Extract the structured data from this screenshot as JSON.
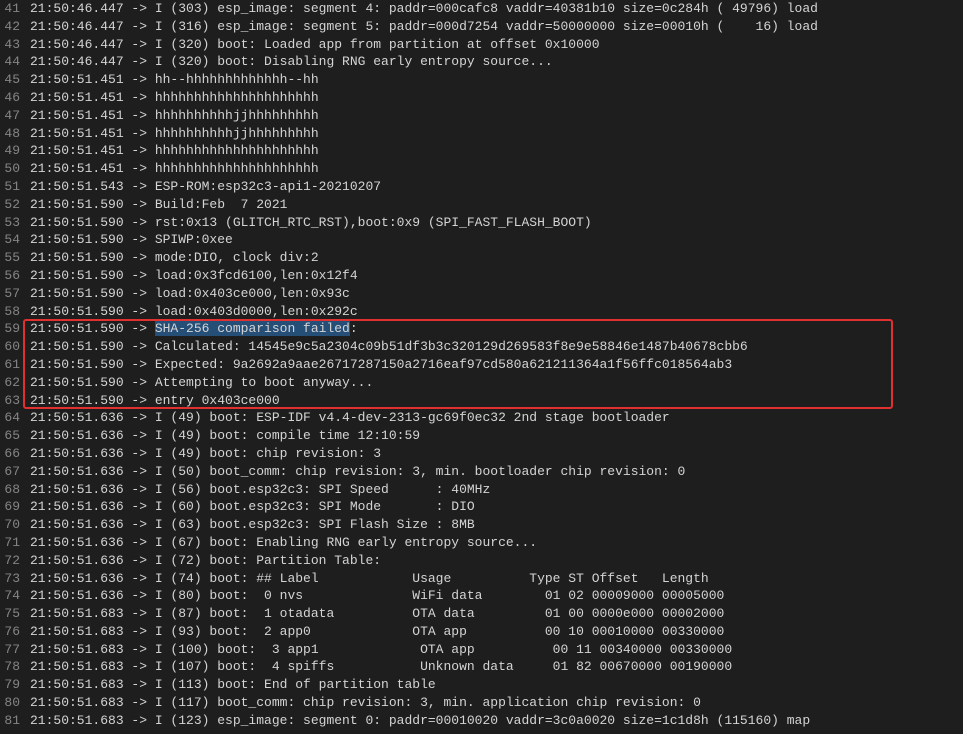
{
  "lines": [
    {
      "num": "41",
      "text": "21:50:46.447 -> I (303) esp_image: segment 4: paddr=000cafc8 vaddr=40381b10 size=0c284h ( 49796) load"
    },
    {
      "num": "42",
      "text": "21:50:46.447 -> I (316) esp_image: segment 5: paddr=000d7254 vaddr=50000000 size=00010h (    16) load"
    },
    {
      "num": "43",
      "text": "21:50:46.447 -> I (320) boot: Loaded app from partition at offset 0x10000"
    },
    {
      "num": "44",
      "text": "21:50:46.447 -> I (320) boot: Disabling RNG early entropy source..."
    },
    {
      "num": "45",
      "text": "21:50:51.451 -> hh--hhhhhhhhhhhhh--hh"
    },
    {
      "num": "46",
      "text": "21:50:51.451 -> hhhhhhhhhhhhhhhhhhhhh"
    },
    {
      "num": "47",
      "text": "21:50:51.451 -> hhhhhhhhhhjjhhhhhhhhh"
    },
    {
      "num": "48",
      "text": "21:50:51.451 -> hhhhhhhhhhjjhhhhhhhhh"
    },
    {
      "num": "49",
      "text": "21:50:51.451 -> hhhhhhhhhhhhhhhhhhhhh"
    },
    {
      "num": "50",
      "text": "21:50:51.451 -> hhhhhhhhhhhhhhhhhhhhh"
    },
    {
      "num": "51",
      "text": "21:50:51.543 -> ESP-ROM:esp32c3-api1-20210207"
    },
    {
      "num": "52",
      "text": "21:50:51.590 -> Build:Feb  7 2021"
    },
    {
      "num": "53",
      "text": "21:50:51.590 -> rst:0x13 (GLITCH_RTC_RST),boot:0x9 (SPI_FAST_FLASH_BOOT)"
    },
    {
      "num": "54",
      "text": "21:50:51.590 -> SPIWP:0xee"
    },
    {
      "num": "55",
      "text": "21:50:51.590 -> mode:DIO, clock div:2"
    },
    {
      "num": "56",
      "text": "21:50:51.590 -> load:0x3fcd6100,len:0x12f4"
    },
    {
      "num": "57",
      "text": "21:50:51.590 -> load:0x403ce000,len:0x93c"
    },
    {
      "num": "58",
      "text": "21:50:51.590 -> load:0x403d0000,len:0x292c"
    },
    {
      "num": "59",
      "prefix": "21:50:51.590 -> ",
      "selected": "SHA-256 comparison failed",
      "suffix": ":"
    },
    {
      "num": "60",
      "text": "21:50:51.590 -> Calculated: 14545e9c5a2304c09b51df3b3c320129d269583f8e9e58846e1487b40678cbb6"
    },
    {
      "num": "61",
      "text": "21:50:51.590 -> Expected: 9a2692a9aae26717287150a2716eaf97cd580a621211364a1f56ffc018564ab3"
    },
    {
      "num": "62",
      "text": "21:50:51.590 -> Attempting to boot anyway..."
    },
    {
      "num": "63",
      "text": "21:50:51.590 -> entry 0x403ce000"
    },
    {
      "num": "64",
      "text": "21:50:51.636 -> I (49) boot: ESP-IDF v4.4-dev-2313-gc69f0ec32 2nd stage bootloader"
    },
    {
      "num": "65",
      "text": "21:50:51.636 -> I (49) boot: compile time 12:10:59"
    },
    {
      "num": "66",
      "text": "21:50:51.636 -> I (49) boot: chip revision: 3"
    },
    {
      "num": "67",
      "text": "21:50:51.636 -> I (50) boot_comm: chip revision: 3, min. bootloader chip revision: 0"
    },
    {
      "num": "68",
      "text": "21:50:51.636 -> I (56) boot.esp32c3: SPI Speed      : 40MHz"
    },
    {
      "num": "69",
      "text": "21:50:51.636 -> I (60) boot.esp32c3: SPI Mode       : DIO"
    },
    {
      "num": "70",
      "text": "21:50:51.636 -> I (63) boot.esp32c3: SPI Flash Size : 8MB"
    },
    {
      "num": "71",
      "text": "21:50:51.636 -> I (67) boot: Enabling RNG early entropy source..."
    },
    {
      "num": "72",
      "text": "21:50:51.636 -> I (72) boot: Partition Table:"
    },
    {
      "num": "73",
      "text": "21:50:51.636 -> I (74) boot: ## Label            Usage          Type ST Offset   Length"
    },
    {
      "num": "74",
      "text": "21:50:51.636 -> I (80) boot:  0 nvs              WiFi data        01 02 00009000 00005000"
    },
    {
      "num": "75",
      "text": "21:50:51.683 -> I (87) boot:  1 otadata          OTA data         01 00 0000e000 00002000"
    },
    {
      "num": "76",
      "text": "21:50:51.683 -> I (93) boot:  2 app0             OTA app          00 10 00010000 00330000"
    },
    {
      "num": "77",
      "text": "21:50:51.683 -> I (100) boot:  3 app1             OTA app          00 11 00340000 00330000"
    },
    {
      "num": "78",
      "text": "21:50:51.683 -> I (107) boot:  4 spiffs           Unknown data     01 82 00670000 00190000"
    },
    {
      "num": "79",
      "text": "21:50:51.683 -> I (113) boot: End of partition table"
    },
    {
      "num": "80",
      "text": "21:50:51.683 -> I (117) boot_comm: chip revision: 3, min. application chip revision: 0"
    },
    {
      "num": "81",
      "text": "21:50:51.683 -> I (123) esp_image: segment 0: paddr=00010020 vaddr=3c0a0020 size=1c1d8h (115160) map"
    }
  ]
}
